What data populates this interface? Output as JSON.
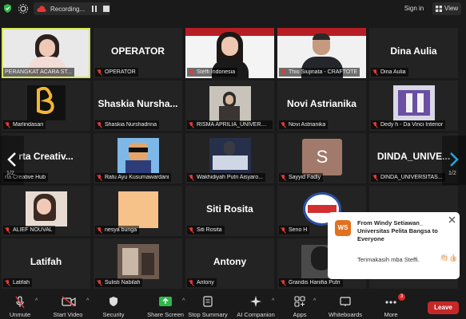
{
  "topbar": {
    "recording_label": "Recording...",
    "signin_label": "Sign in",
    "view_label": "View"
  },
  "tiles": [
    {
      "name": "PERANGKAT ACARA ST...",
      "big": ""
    },
    {
      "name": "OPERATOR",
      "big": "OPERATOR"
    },
    {
      "name": "Steffi Indonesia",
      "big": ""
    },
    {
      "name": "Thio Siujinata - CRAFTOTE",
      "big": ""
    },
    {
      "name": "Dina Aulia",
      "big": "Dina Aulia"
    },
    {
      "name": "Marlindasari",
      "big": ""
    },
    {
      "name": "Shaskia Nurshadrina",
      "big": "Shaskia  Nursha..."
    },
    {
      "name": "RISMA APRILIA_UNIVERSI...",
      "big": ""
    },
    {
      "name": "Novi Astrianika",
      "big": "Novi Astrianika"
    },
    {
      "name": "Dedy h - Da Vinci Interior",
      "big": ""
    },
    {
      "name": "rta Creative Hub",
      "big": "rta  Creativ..."
    },
    {
      "name": "Ratu Ayu Kusumawardani",
      "big": ""
    },
    {
      "name": "Wakhidiyah Putri Aisyaro...",
      "big": ""
    },
    {
      "name": "Sayyid Fadly",
      "big": ""
    },
    {
      "name": "DINDA_UNIVERSITAS...",
      "big": "DINDA_UNIVE..."
    },
    {
      "name": "ALIEF NOUVAL",
      "big": ""
    },
    {
      "name": "nesya bunga",
      "big": ""
    },
    {
      "name": "Siti Rosita",
      "big": "Siti Rosita"
    },
    {
      "name": "Seno H",
      "big": ""
    },
    {
      "name": "",
      "big": ""
    },
    {
      "name": "Latifah",
      "big": "Latifah"
    },
    {
      "name": "Sulisti Nabilah",
      "big": ""
    },
    {
      "name": "Antony",
      "big": "Antony"
    },
    {
      "name": "Grandis Hanifia Putri",
      "big": ""
    },
    {
      "name": "",
      "big": ""
    }
  ],
  "avatar_letter": "S",
  "page_indicator_left": "1/2",
  "page_indicator_right": "1/2",
  "chat": {
    "initials": "WS",
    "from": "From Windy Setiawan_ Universitas Pelita Bangsa to Everyone",
    "message": "Terimakasih mba Steffi.",
    "emoji": "👏🏻👍🏻"
  },
  "toolbar": {
    "unmute": "Unmute",
    "start_video": "Start Video",
    "security": "Security",
    "share_screen": "Share Screen",
    "stop_summary": "Stop Summary",
    "ai_companion": "AI Companion",
    "apps": "Apps",
    "whiteboards": "Whiteboards",
    "more": "More",
    "more_badge": "3",
    "leave": "Leave"
  },
  "colors": {
    "active_speaker": "#d7e65a",
    "leave": "#c62828",
    "share": "#2eb84b",
    "chat_avatar": "#e2701d"
  }
}
